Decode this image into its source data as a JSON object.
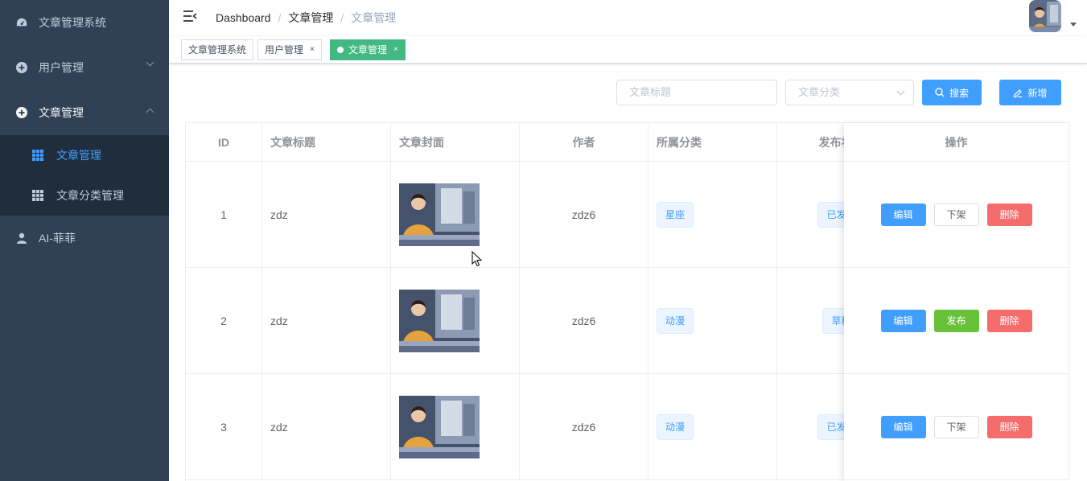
{
  "sidebar": {
    "logo_title": "文章管理系统",
    "items": [
      {
        "label": "用户管理"
      },
      {
        "label": "文章管理"
      },
      {
        "label": "AI-菲菲"
      }
    ],
    "submenu": [
      {
        "label": "文章管理"
      },
      {
        "label": "文章分类管理"
      }
    ]
  },
  "header": {
    "breadcrumb": [
      "Dashboard",
      "文章管理",
      "文章管理"
    ]
  },
  "tags": [
    {
      "label": "文章管理系统"
    },
    {
      "label": "用户管理",
      "close": "×"
    },
    {
      "label": "文章管理",
      "close": "×"
    }
  ],
  "toolbar": {
    "title_placeholder": "文章标题",
    "category_placeholder": "文章分类",
    "search_label": "搜索",
    "add_label": "新增"
  },
  "table": {
    "headers": [
      "ID",
      "文章标题",
      "文章封面",
      "作者",
      "所属分类",
      "发布状态",
      "操作"
    ],
    "rows": [
      {
        "id": "1",
        "title": "zdz",
        "author": "zdz6",
        "category": "星座",
        "status": "已发布",
        "toggle": "下架"
      },
      {
        "id": "2",
        "title": "zdz",
        "author": "zdz6",
        "category": "动漫",
        "status": "草稿",
        "toggle": "发布"
      },
      {
        "id": "3",
        "title": "zdz",
        "author": "zdz6",
        "category": "动漫",
        "status": "已发布",
        "toggle": "下架"
      }
    ],
    "edit_label": "编辑",
    "delete_label": "删除"
  },
  "colors": {
    "sidebar_bg": "#304156",
    "submenu_bg": "#1f2d3d",
    "primary": "#409eff",
    "success": "#67c23a",
    "danger": "#f56c6c",
    "active_tag": "#42b983"
  }
}
